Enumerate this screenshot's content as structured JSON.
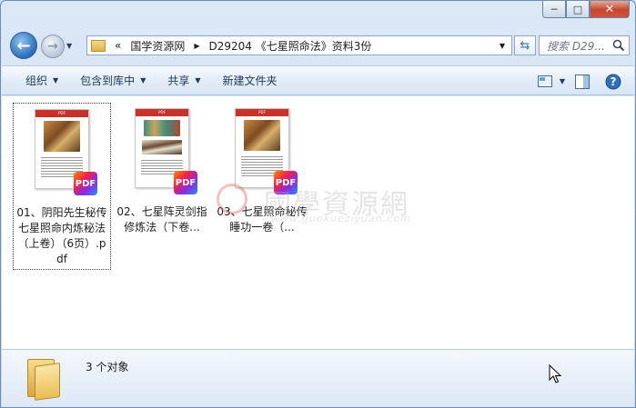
{
  "window": {
    "caption": {
      "minimize": "─",
      "maximize": "□",
      "close": "✕"
    }
  },
  "nav": {
    "back_glyph": "←",
    "forward_glyph": "→",
    "breadcrumb_overflow": "«",
    "breadcrumb": [
      "国学资源网",
      "D29204 《七星照命法》资料3份"
    ],
    "search_placeholder": "搜索 D29..."
  },
  "toolbar": {
    "organize": "组织",
    "include_in_library": "包含到库中",
    "share": "共享",
    "new_folder": "新建文件夹"
  },
  "files": [
    {
      "name": "01、阴阳先生秘传七星照命内炼秘法（上卷）（6页）.pdf",
      "badge": "PDF",
      "header": "PDF",
      "selected": true
    },
    {
      "name": "02、七星阵灵剑指修炼法（下卷...",
      "badge": "PDF",
      "header": "PDF",
      "selected": false
    },
    {
      "name": "03、七星照命秘传睡功一卷（...",
      "badge": "PDF",
      "header": "PDF",
      "selected": false
    }
  ],
  "watermark": {
    "text": "國學資源網",
    "url": "www.guoxueziyuan.com"
  },
  "details": {
    "count_text": "3 个对象"
  },
  "colors": {
    "accent": "#2a6cb8",
    "pdf_header": "#c7322a",
    "close_button": "#c7462c"
  }
}
